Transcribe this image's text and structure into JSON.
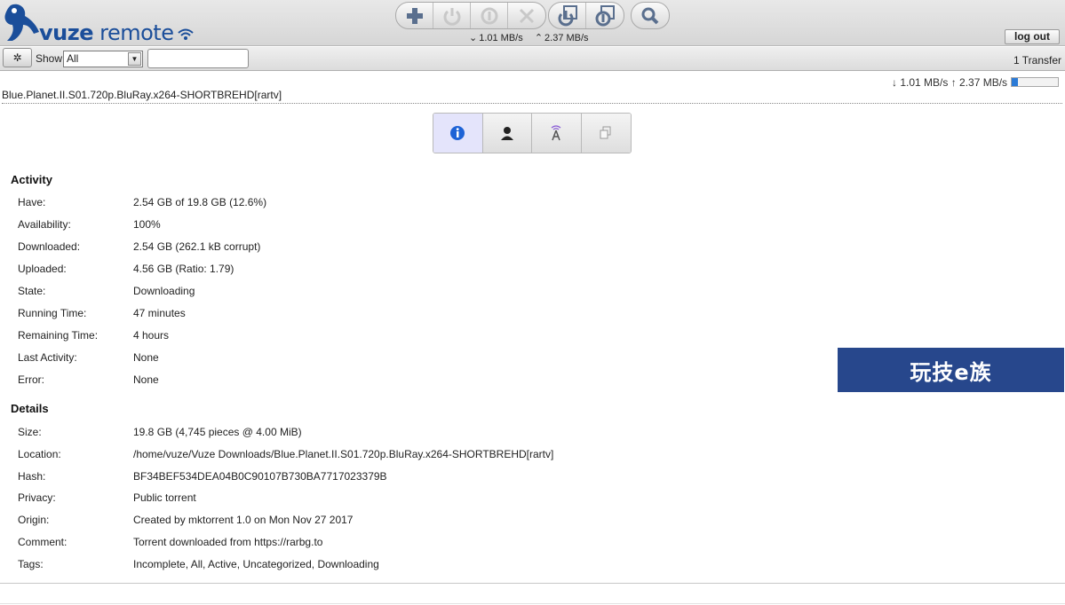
{
  "header": {
    "logo_word1": "vuze",
    "logo_word2": "remote",
    "speed_down": "1.01 MB/s",
    "speed_up": "2.37 MB/s",
    "logout_label": "log out"
  },
  "toolbar": {
    "icons": [
      "add-icon",
      "start-icon",
      "pause-icon",
      "remove-icon",
      "start-all-icon",
      "pause-all-icon",
      "search-icon"
    ]
  },
  "filter": {
    "show_label": "Show",
    "show_selected": "All",
    "search_value": "",
    "transfer_count": "1 Transfer"
  },
  "torrent": {
    "name": "Blue.Planet.II.S01.720p.BluRay.x264-SHORTBREHD[rartv]",
    "rate_text": "↓ 1.01 MB/s ↑ 2.37 MB/s",
    "progress": 0.126
  },
  "tabs": [
    {
      "name": "info",
      "active": true
    },
    {
      "name": "peers",
      "active": false
    },
    {
      "name": "trackers",
      "active": false
    },
    {
      "name": "files",
      "active": false
    }
  ],
  "activity": {
    "title": "Activity",
    "rows": [
      {
        "label": "Have:",
        "value": "2.54 GB of 19.8 GB (12.6%)"
      },
      {
        "label": "Availability:",
        "value": "100%"
      },
      {
        "label": "Downloaded:",
        "value": "2.54 GB (262.1 kB corrupt)"
      },
      {
        "label": "Uploaded:",
        "value": "4.56 GB (Ratio: 1.79)"
      },
      {
        "label": "State:",
        "value": "Downloading"
      },
      {
        "label": "Running Time:",
        "value": "47 minutes"
      },
      {
        "label": "Remaining Time:",
        "value": "4 hours"
      },
      {
        "label": "Last Activity:",
        "value": "None"
      },
      {
        "label": "Error:",
        "value": "None"
      }
    ]
  },
  "details": {
    "title": "Details",
    "rows": [
      {
        "label": "Size:",
        "value": "19.8 GB (4,745 pieces @ 4.00 MiB)"
      },
      {
        "label": "Location:",
        "value": "/home/vuze/Vuze Downloads/Blue.Planet.II.S01.720p.BluRay.x264-SHORTBREHD[rartv]"
      },
      {
        "label": "Hash:",
        "value": "BF34BEF534DEA04B0C90107B730BA7717023379B"
      },
      {
        "label": "Privacy:",
        "value": "Public torrent"
      },
      {
        "label": "Origin:",
        "value": "Created by mktorrent 1.0 on Mon Nov 27 2017"
      },
      {
        "label": "Comment:",
        "value": "Torrent downloaded from https://rarbg.to"
      },
      {
        "label": "Tags:",
        "value": "Incomplete, All, Active, Uncategorized, Downloading"
      }
    ]
  },
  "watermark": {
    "text": "玩技e族"
  }
}
